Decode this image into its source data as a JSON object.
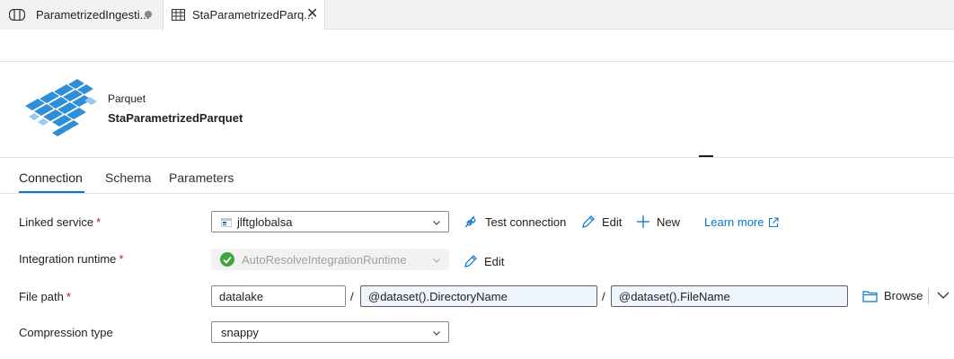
{
  "tabs": [
    {
      "label": "ParametrizedIngesti...",
      "state": "unsaved"
    },
    {
      "label": "StaParametrizedParq...",
      "state": "active",
      "close": "✕"
    }
  ],
  "dataset": {
    "type": "Parquet",
    "name": "StaParametrizedParquet"
  },
  "property_tabs": {
    "connection": "Connection",
    "schema": "Schema",
    "parameters": "Parameters"
  },
  "form": {
    "linked_service": {
      "label": "Linked service",
      "required": "*",
      "value": "jlftglobalsa"
    },
    "integration_runtime": {
      "label": "Integration runtime",
      "required": "*",
      "value": "AutoResolveIntegrationRuntime"
    },
    "file_path": {
      "label": "File path",
      "required": "*",
      "container": "datalake",
      "separator": "/",
      "directory": "@dataset().DirectoryName",
      "file": "@dataset().FileName"
    },
    "compression_type": {
      "label": "Compression type",
      "value": "snappy"
    }
  },
  "actions": {
    "test_connection": "Test connection",
    "edit": "Edit",
    "new": "New",
    "learn_more": "Learn more",
    "browse": "Browse"
  },
  "colors": {
    "accent": "#0078d4",
    "success": "#107c10",
    "required": "#a4262c"
  }
}
